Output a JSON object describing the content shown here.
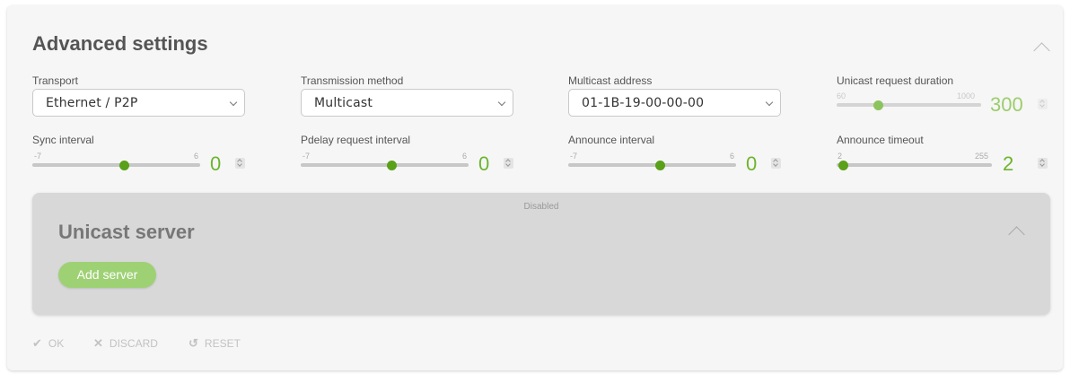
{
  "header": {
    "title": "Advanced settings"
  },
  "fields": {
    "transport": {
      "label": "Transport",
      "value": "Ethernet / P2P"
    },
    "transmission": {
      "label": "Transmission method",
      "value": "Multicast"
    },
    "multicast": {
      "label": "Multicast address",
      "value": "01-1B-19-00-00-00"
    },
    "unicast_duration": {
      "label": "Unicast request duration",
      "min": "60",
      "max": "1000",
      "value": "300"
    },
    "sync_interval": {
      "label": "Sync interval",
      "min": "-7",
      "max": "6",
      "value": "0"
    },
    "pdelay_interval": {
      "label": "Pdelay request interval",
      "min": "-7",
      "max": "6",
      "value": "0"
    },
    "announce_interval": {
      "label": "Announce interval",
      "min": "-7",
      "max": "6",
      "value": "0"
    },
    "announce_timeout": {
      "label": "Announce timeout",
      "min": "2",
      "max": "255",
      "value": "2"
    }
  },
  "unicast_server": {
    "status": "Disabled",
    "title": "Unicast server",
    "add_label": "Add server"
  },
  "footer": {
    "ok": "OK",
    "discard": "DISCARD",
    "reset": "RESET"
  },
  "colors": {
    "accent": "#6cb52d",
    "knob": "#5aa018",
    "button": "#9ed174"
  },
  "icons": [
    "chevron-up-icon",
    "select-caret-icon",
    "spinner-icon",
    "check-icon",
    "x-icon",
    "reset-icon"
  ]
}
